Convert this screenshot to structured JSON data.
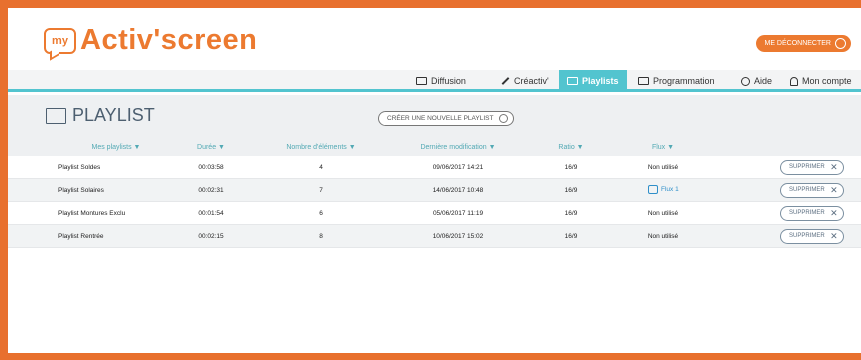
{
  "brand": {
    "badge": "my",
    "name": "Activ'screen",
    "accent": "#ec7a30",
    "nav_accent": "#52c4cf"
  },
  "header": {
    "logout_label": "ME DÉCONNECTER"
  },
  "nav": {
    "items": [
      {
        "label": "Diffusion",
        "icon": "screen-icon"
      },
      {
        "label": "Créactiv'",
        "icon": "pen-icon"
      },
      {
        "label": "Playlists",
        "icon": "playlist-icon",
        "active": true
      },
      {
        "label": "Programmation",
        "icon": "calendar-icon"
      },
      {
        "label": "Aide",
        "icon": "info-icon"
      },
      {
        "label": "Mon compte",
        "icon": "user-icon"
      }
    ]
  },
  "page": {
    "title": "PLAYLIST",
    "create_label": "CRÉER UNE NOUVELLE PLAYLIST"
  },
  "table": {
    "columns": [
      "Mes playlists ▼",
      "Durée ▼",
      "Nombre d'éléments ▼",
      "Dernière modification ▼",
      "Ratio ▼",
      "Flux ▼"
    ],
    "rows": [
      {
        "name": "Playlist Soldes",
        "duree": "00:03:58",
        "nb": "4",
        "modif": "09/06/2017 14:21",
        "ratio": "16/9",
        "flux": "Non utilisé",
        "action": "SUPPRIMER"
      },
      {
        "name": "Playlist Solaires",
        "duree": "00:02:31",
        "nb": "7",
        "modif": "14/06/2017 10:48",
        "ratio": "16/9",
        "flux": "Flux 1",
        "action": "SUPPRIMER"
      },
      {
        "name": "Playlist Montures Exclu",
        "duree": "00:01:54",
        "nb": "6",
        "modif": "05/06/2017 11:19",
        "ratio": "16/9",
        "flux": "Non utilisé",
        "action": "SUPPRIMER"
      },
      {
        "name": "Playlist Rentrée",
        "duree": "00:02:15",
        "nb": "8",
        "modif": "10/06/2017 15:02",
        "ratio": "16/9",
        "flux": "Non utilisé",
        "action": "SUPPRIMER"
      }
    ]
  }
}
